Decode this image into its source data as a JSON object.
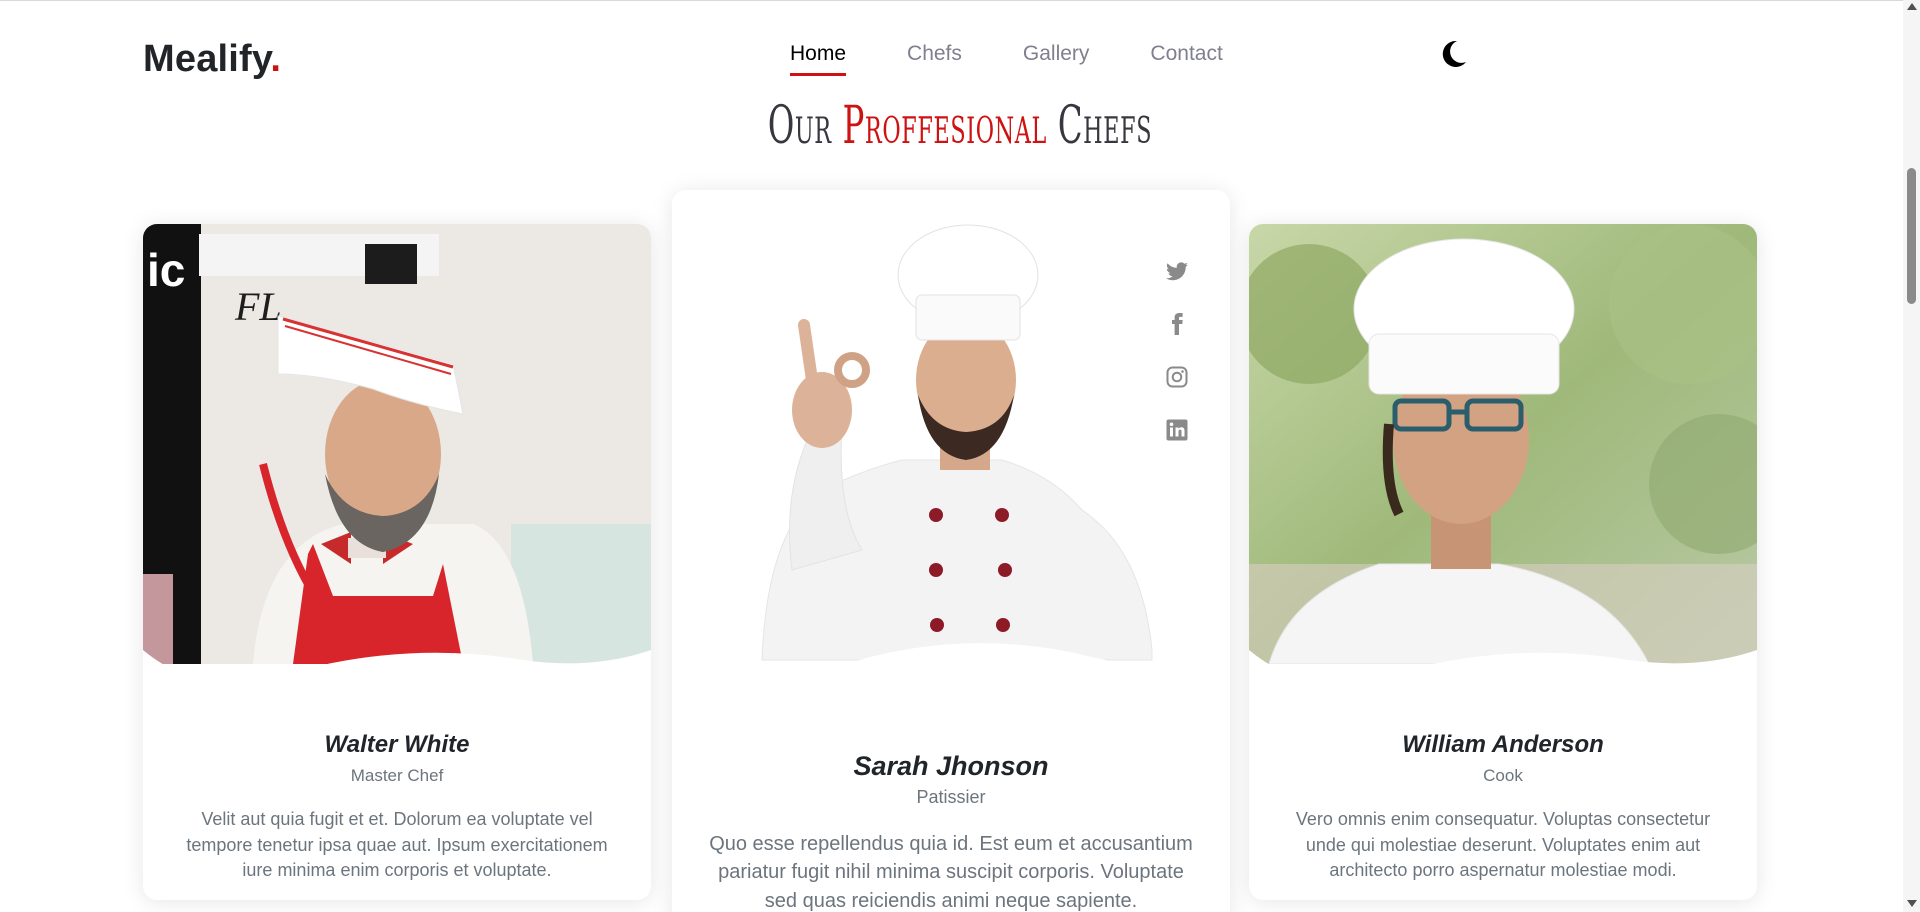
{
  "header": {
    "logo_text": "Mealify",
    "logo_dot": ".",
    "nav": [
      {
        "label": "Home",
        "active": true
      },
      {
        "label": "Chefs",
        "active": false
      },
      {
        "label": "Gallery",
        "active": false
      },
      {
        "label": "Contact",
        "active": false
      }
    ],
    "theme_toggle_icon": "moon-icon"
  },
  "section": {
    "title_prefix": "Our ",
    "title_accent": "Proffesional",
    "title_suffix": " Chefs"
  },
  "chefs": [
    {
      "name": "Walter White",
      "role": "Master Chef",
      "description": "Velit aut quia fugit et et. Dolorum ea voluptate vel tempore tenetur ipsa quae aut. Ipsum exercitationem iure minima enim corporis et voluptate."
    },
    {
      "name": "Sarah Jhonson",
      "role": "Patissier",
      "description": "Quo esse repellendus quia id. Est eum et accusantium pariatur fugit nihil minima suscipit corporis. Voluptate sed quas reiciendis animi neque sapiente.",
      "social": [
        "twitter-icon",
        "facebook-icon",
        "instagram-icon",
        "linkedin-icon"
      ]
    },
    {
      "name": "William Anderson",
      "role": "Cook",
      "description": "Vero omnis enim consequatur. Voluptas consectetur unde qui molestiae deserunt. Voluptates enim aut architecto porro aspernatur molestiae modi."
    }
  ],
  "colors": {
    "accent": "#ce1212",
    "text_dark": "#212529",
    "text_muted": "#6c757d",
    "nav_inactive": "#7f7f90",
    "icon_gray": "#8a8a8a"
  }
}
